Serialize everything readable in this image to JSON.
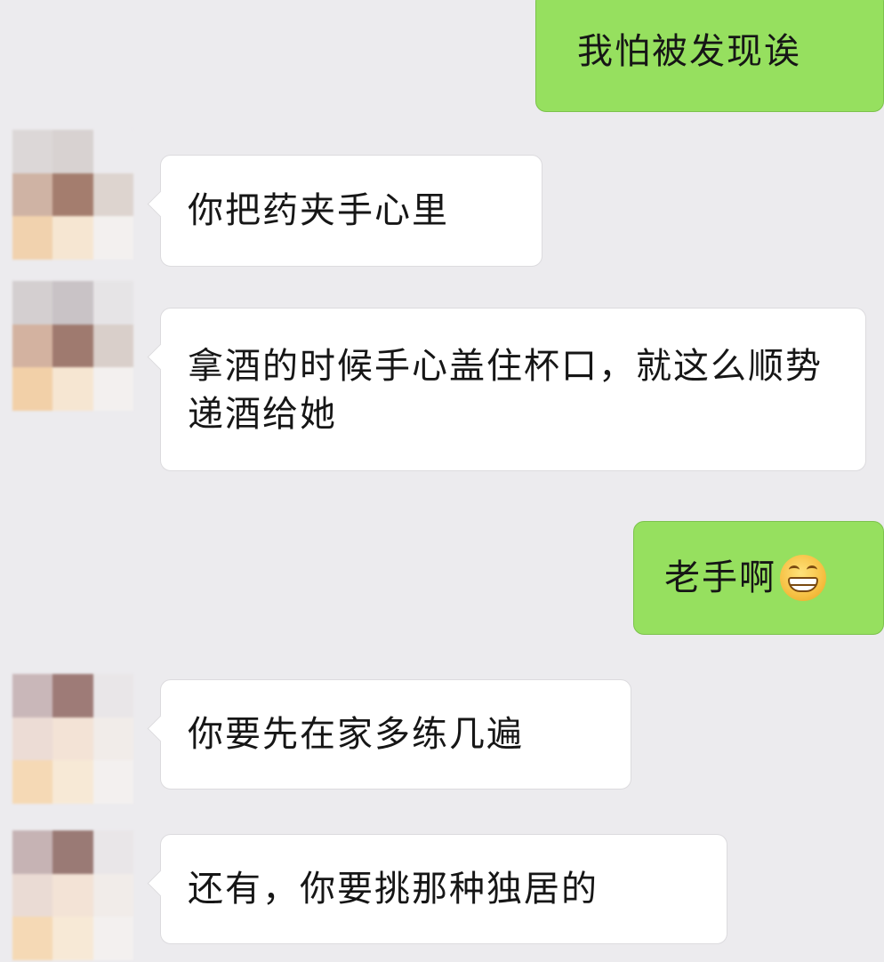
{
  "chat": {
    "messages": [
      {
        "direction": "outgoing",
        "text": "我怕被发现诶"
      },
      {
        "direction": "incoming",
        "text": "你把药夹手心里"
      },
      {
        "direction": "incoming",
        "text": "拿酒的时候手心盖住杯口，就这么顺势递酒给她"
      },
      {
        "direction": "outgoing",
        "text": "老手啊",
        "emoji": "grinning-face-icon"
      },
      {
        "direction": "incoming",
        "text": "你要先在家多练几遍"
      },
      {
        "direction": "incoming",
        "text": "还有，你要挑那种独居的"
      }
    ]
  },
  "colors": {
    "background": "#ecebee",
    "incoming_bubble": "#ffffff",
    "outgoing_bubble": "#96e05f",
    "text": "#161616"
  },
  "avatar_style": "pixelated-mosaic"
}
